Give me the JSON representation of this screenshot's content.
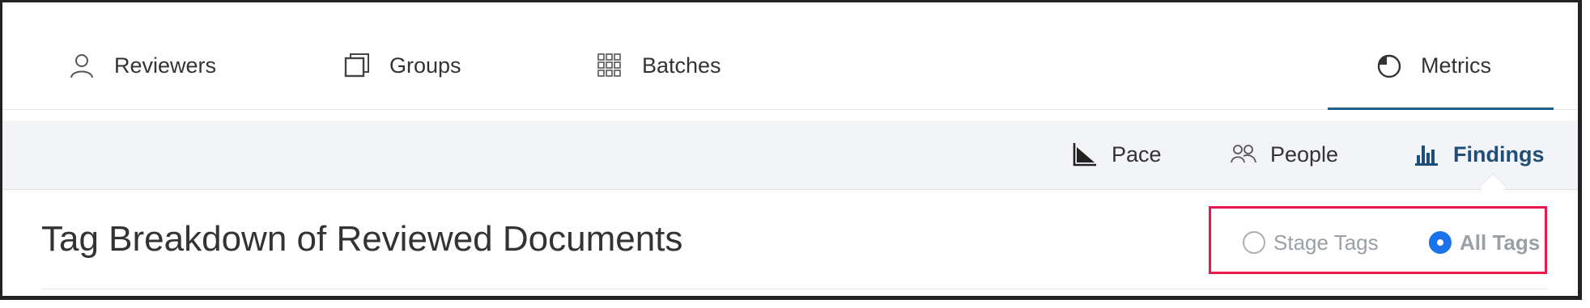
{
  "top_nav": {
    "items": [
      {
        "label": "Reviewers",
        "icon": "person-icon"
      },
      {
        "label": "Groups",
        "icon": "copy-icon"
      },
      {
        "label": "Batches",
        "icon": "grid-icon"
      },
      {
        "label": "Metrics",
        "icon": "pie-chart-icon",
        "active": true
      }
    ]
  },
  "sub_nav": {
    "items": [
      {
        "label": "Pace",
        "icon": "triangle-chart-icon"
      },
      {
        "label": "People",
        "icon": "people-icon"
      },
      {
        "label": "Findings",
        "icon": "bar-chart-icon",
        "active": true
      }
    ]
  },
  "main": {
    "title": "Tag Breakdown of Reviewed Documents",
    "tag_filter": {
      "options": [
        {
          "label": "Stage Tags",
          "selected": false
        },
        {
          "label": "All Tags",
          "selected": true
        }
      ]
    }
  },
  "colors": {
    "accent": "#1f5d8a",
    "radio_selected": "#1a73e8",
    "highlight": "#e8194f",
    "subnav_bg": "#f2f4f7"
  }
}
